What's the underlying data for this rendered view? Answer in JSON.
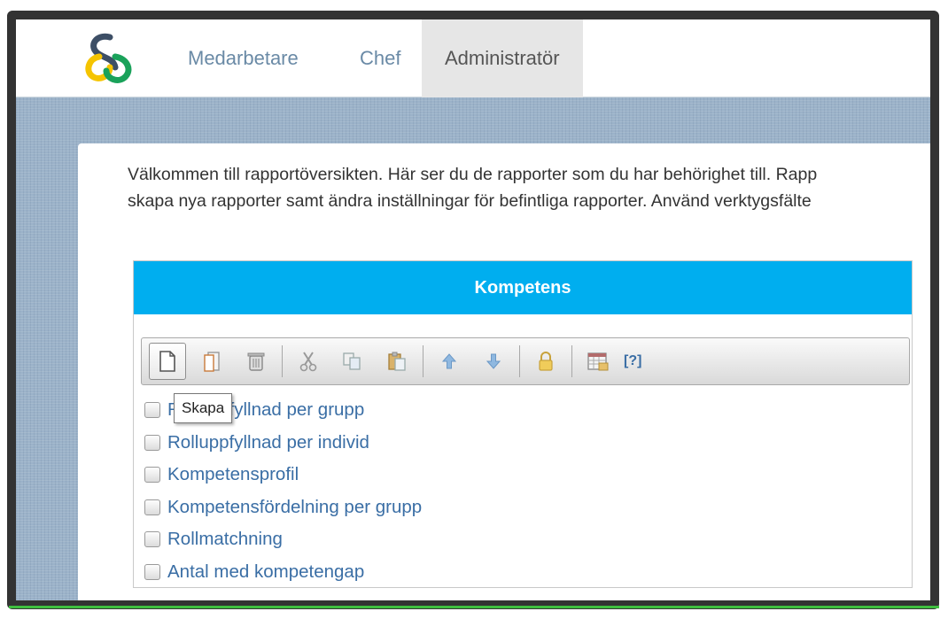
{
  "nav": {
    "items": [
      {
        "label": "Medarbetare"
      },
      {
        "label": "Chef"
      },
      {
        "label": "Administratör"
      }
    ]
  },
  "intro": {
    "line1": "Välkommen till rapportöversikten. Här ser du de rapporter som du har behörighet till. Rapp",
    "line2": "skapa nya rapporter samt ändra inställningar för befintliga rapporter. Använd verktygsfälte"
  },
  "section": {
    "title": "Kompetens",
    "toolbar": {
      "buttons": [
        "new-document-icon",
        "copy-document-icon",
        "trash-icon",
        "cut-icon",
        "copy-icon",
        "paste-icon",
        "arrow-up-icon",
        "arrow-down-icon",
        "lock-icon",
        "calendar-icon"
      ],
      "help_label": "[?]"
    },
    "tooltip": "Skapa",
    "reports": [
      {
        "label": "Rolluppfyllnad per grupp"
      },
      {
        "label": "Rolluppfyllnad per individ"
      },
      {
        "label": "Kompetensprofil"
      },
      {
        "label": "Kompetensfördelning per grupp"
      },
      {
        "label": "Rollmatchning"
      },
      {
        "label": "Antal med kompetengap"
      }
    ]
  },
  "colors": {
    "header": "#00aeef",
    "link": "#3a6ea5",
    "nav_text": "#6a8aa6"
  }
}
